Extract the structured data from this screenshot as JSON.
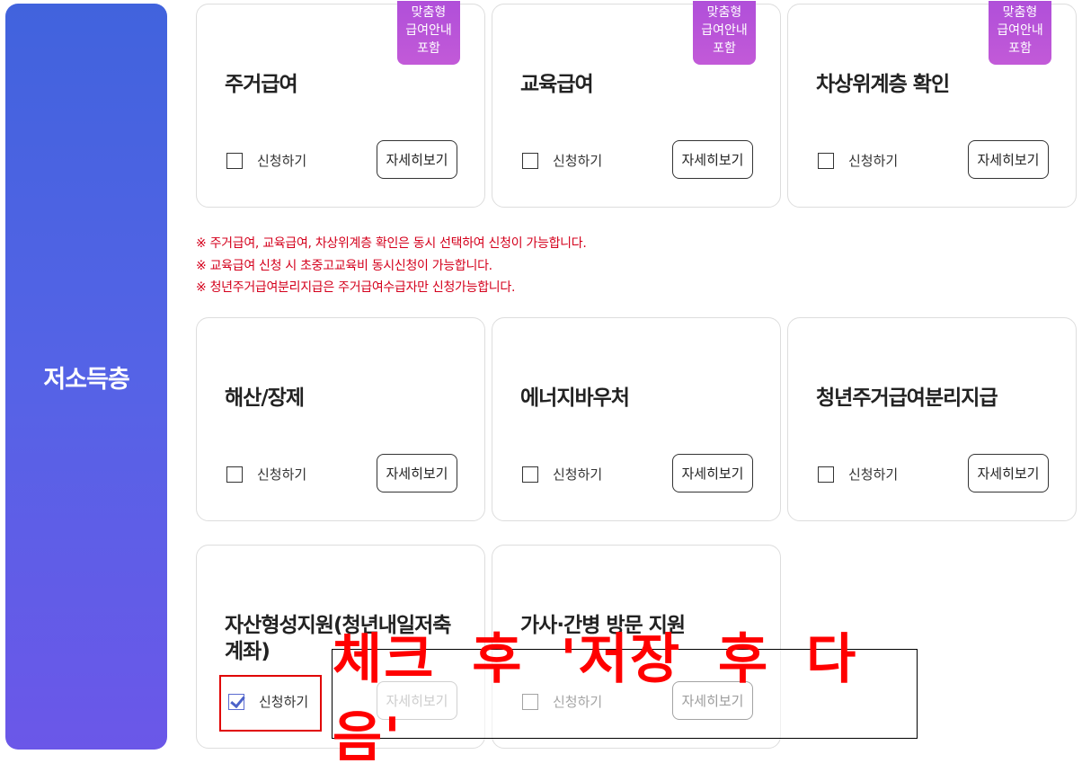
{
  "sidebar": {
    "category_label": "저소득층"
  },
  "badge_text": "맞춤형\n급여안내\n포함",
  "apply_label": "신청하기",
  "detail_label": "자세히보기",
  "cards": [
    {
      "title": "주거급여",
      "badge": true,
      "checked": false
    },
    {
      "title": "교육급여",
      "badge": true,
      "checked": false
    },
    {
      "title": "차상위계층 확인",
      "badge": true,
      "checked": false
    },
    {
      "title": "해산/장제",
      "badge": false,
      "checked": false
    },
    {
      "title": "에너지바우처",
      "badge": false,
      "checked": false
    },
    {
      "title": "청년주거급여분리지급",
      "badge": false,
      "checked": false
    },
    {
      "title": "자산형성지원(청년내일저축계좌)",
      "badge": false,
      "checked": true
    },
    {
      "title": "가사·간병 방문 지원",
      "badge": false,
      "checked": false
    }
  ],
  "notes": [
    "※ 주거급여, 교육급여, 차상위계층 확인은 동시 선택하여 신청이 가능합니다.",
    "※ 교육급여 신청 시 초중고교육비 동시신청이 가능합니다.",
    "※ 청년주거급여분리지급은 주거급여수급자만 신청가능합니다."
  ],
  "annotation": {
    "text": "체크 후 '저장 후 다음'"
  }
}
